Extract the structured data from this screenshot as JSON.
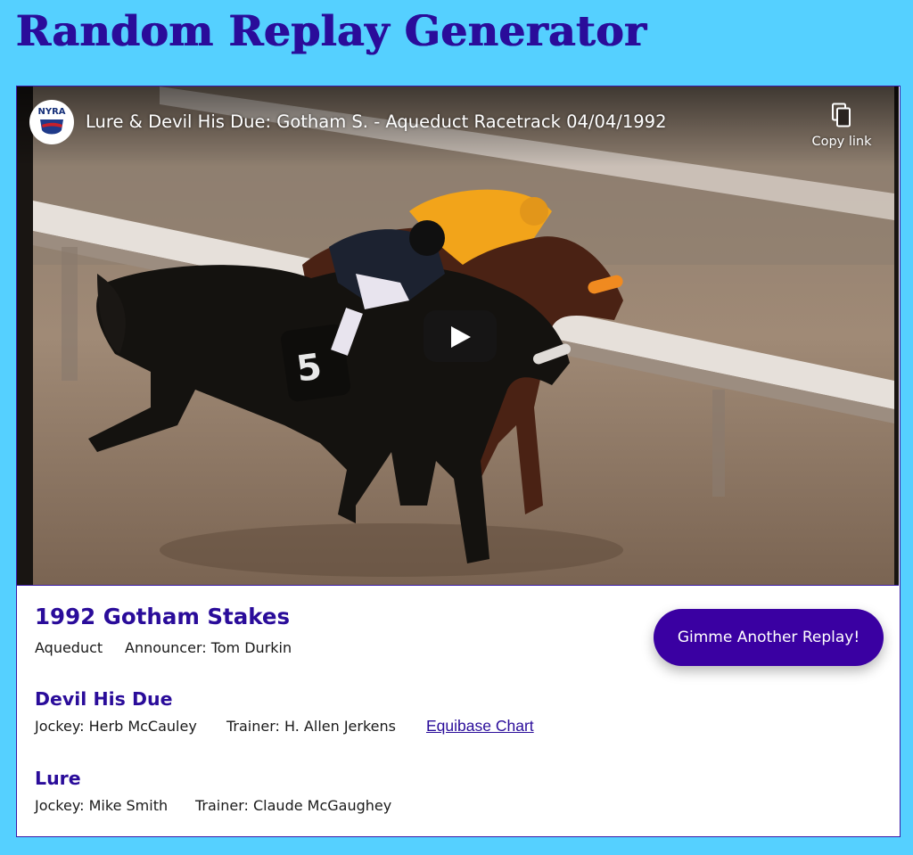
{
  "page": {
    "title": "Random Replay Generator",
    "accent_color": "#2a0c9a",
    "background_color": "#55d0ff"
  },
  "video": {
    "channel_logo_text": "NYRA",
    "title": "Lure & Devil His Due: Gotham S. - Aqueduct Racetrack 04/04/1992",
    "copy_link_label": "Copy link",
    "copy_icon": "copy-icon",
    "play_icon": "play-icon",
    "saddle_cloth_number": "5"
  },
  "race": {
    "name": "1992 Gotham Stakes",
    "track": "Aqueduct",
    "announcer": "Announcer: Tom Durkin"
  },
  "action": {
    "replay_label": "Gimme Another Replay!"
  },
  "winner": {
    "name": "Devil His Due",
    "jockey": "Jockey: Herb McCauley",
    "trainer": "Trainer: H. Allen Jerkens",
    "chart_link": "Equibase Chart"
  },
  "runner_up": {
    "name": "Lure",
    "jockey": "Jockey: Mike Smith",
    "trainer": "Trainer: Claude McGaughey"
  }
}
